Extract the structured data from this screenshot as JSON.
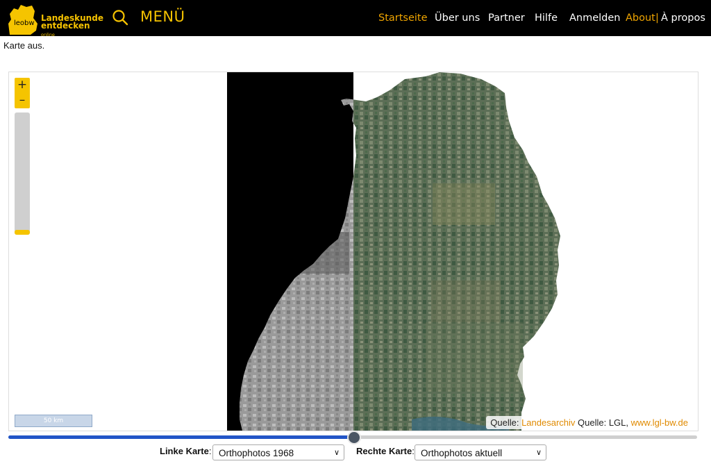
{
  "header": {
    "logo": {
      "badge": "leobw",
      "line1": "Landeskunde",
      "line2": "entdecken",
      "line2_suffix": "online"
    },
    "search_icon": "search-icon",
    "menu_label": "MENÜ",
    "nav": {
      "home": "Startseite",
      "about_us": "Über uns",
      "partner": "Partner",
      "help": "Hilfe",
      "login": "Anmelden",
      "about": "About",
      "separator": "|",
      "apropos": "À propos"
    },
    "colors": {
      "bar": "#000000",
      "accent": "#f5c200",
      "active_link": "#f0a500"
    }
  },
  "intro_text": "Karte aus.",
  "map": {
    "zoom_in": "+",
    "zoom_out": "–",
    "scale_label": "50 km",
    "attribution": {
      "prefix1": "Quelle: ",
      "link1": "Landesarchiv",
      "prefix2": " Quelle: LGL, ",
      "link2": "www.lgl-bw.de"
    }
  },
  "swipe": {
    "position_fraction": 0.5
  },
  "controls": {
    "left_label": "Linke Karte",
    "left_value": "Orthophotos 1968",
    "right_label": "Rechte Karte",
    "right_value": "Orthophotos aktuell",
    "colon": ":"
  }
}
